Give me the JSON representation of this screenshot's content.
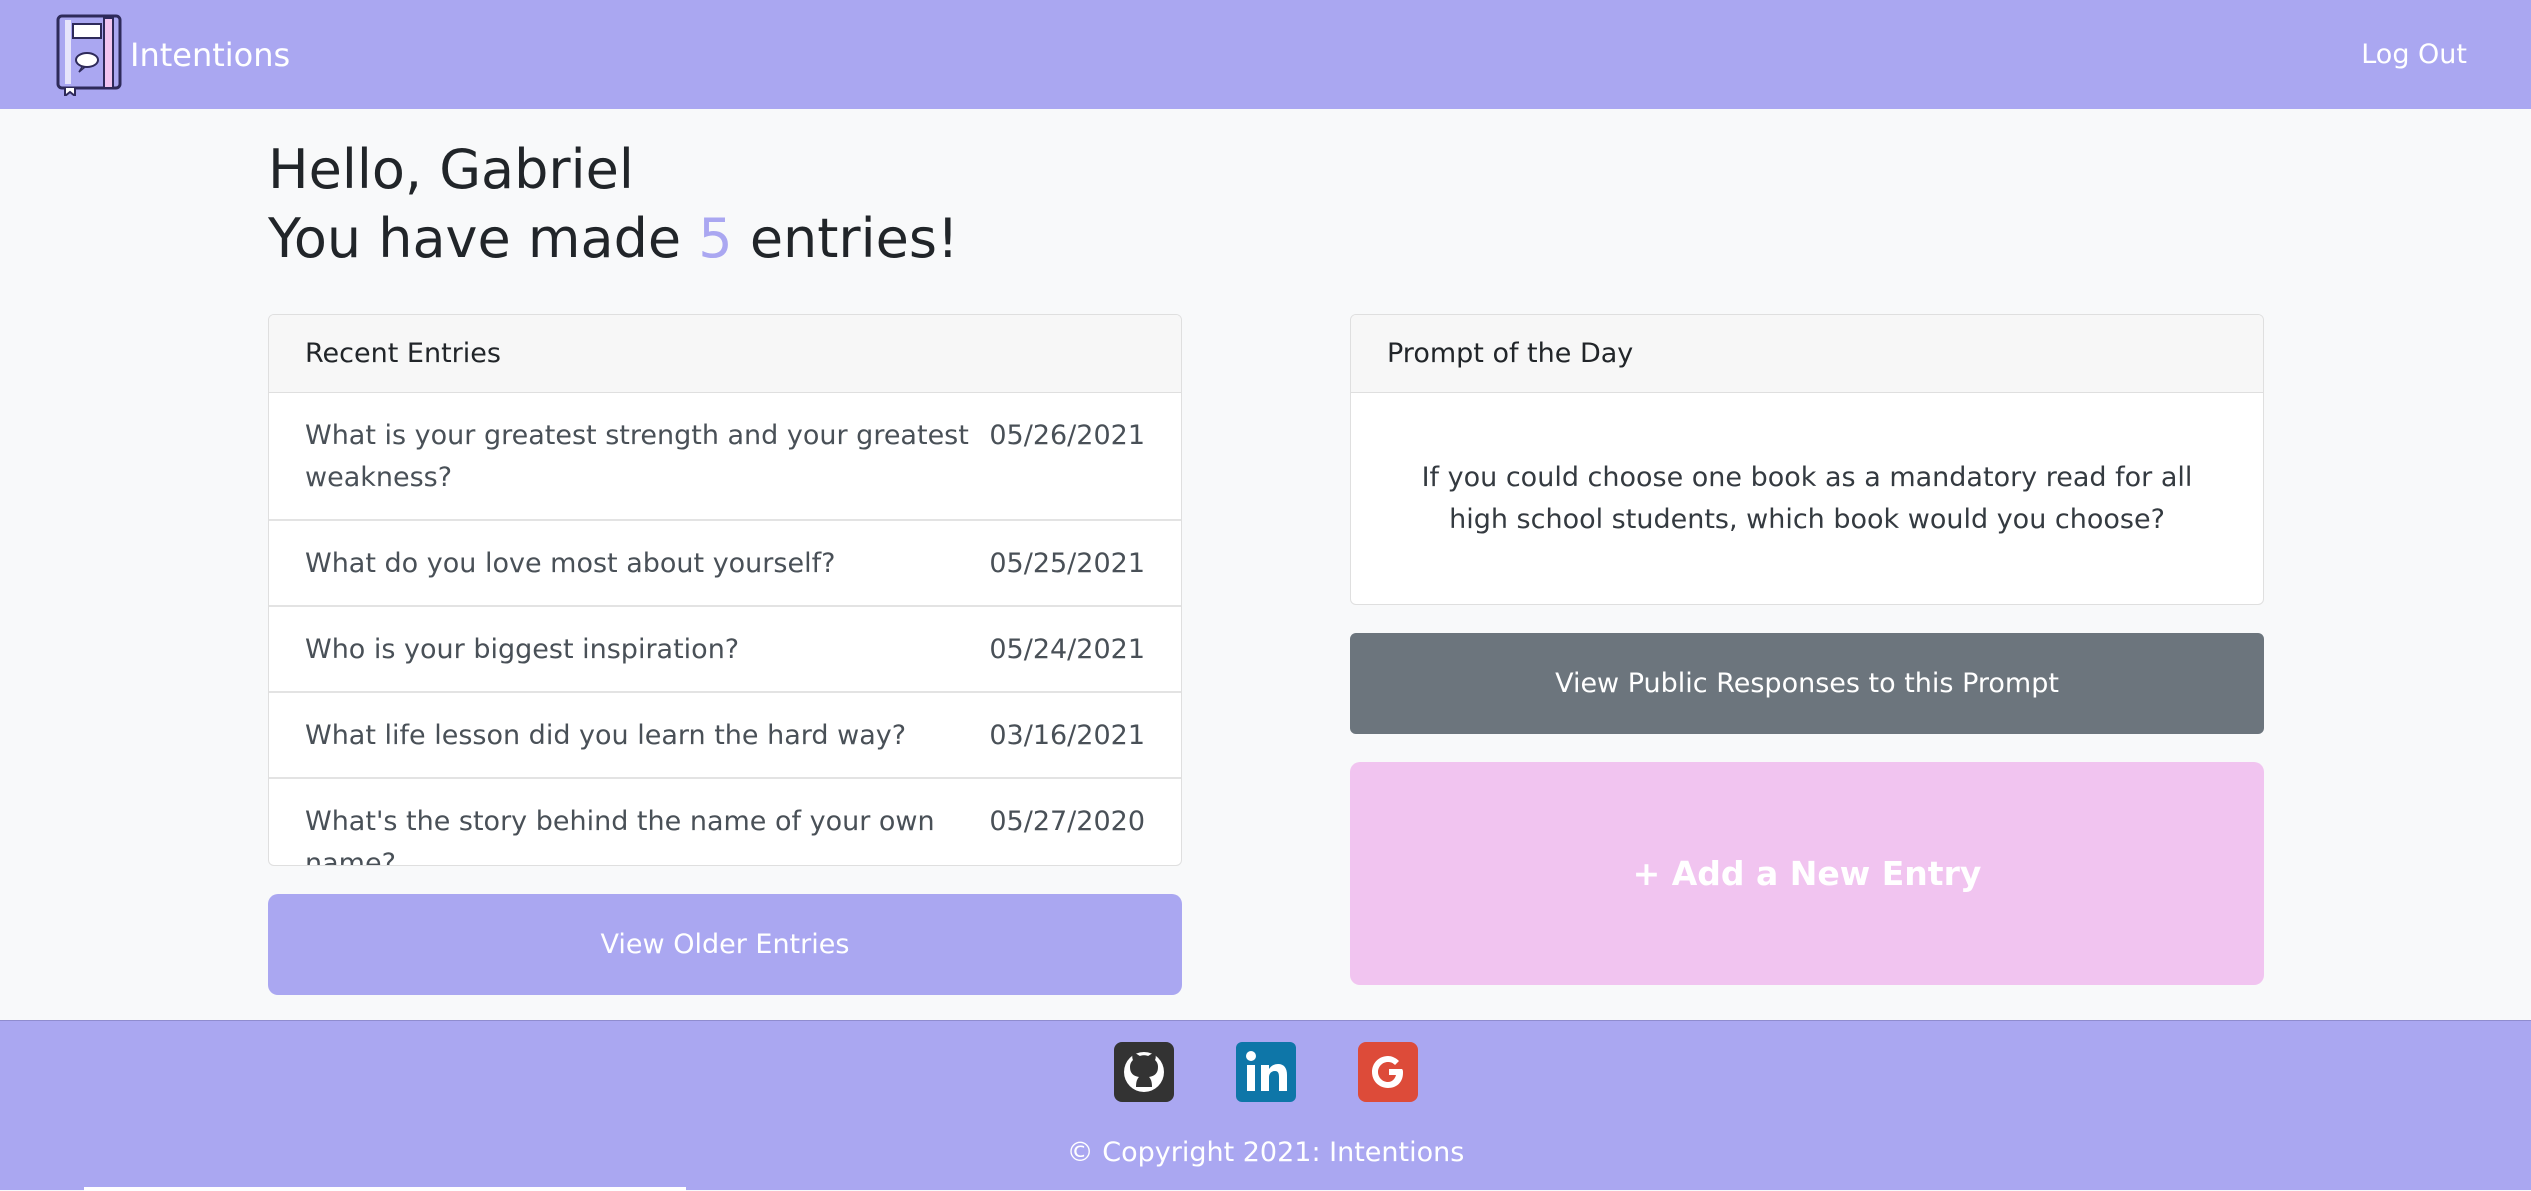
{
  "app": {
    "brand": "Intentions",
    "logout_label": "Log Out"
  },
  "greeting": {
    "hello": "Hello, Gabriel",
    "prefix": "You have made",
    "count": "5",
    "suffix": "entries!"
  },
  "recent": {
    "header": "Recent Entries",
    "entries": [
      {
        "question": "What is your greatest strength and your greatest weakness?",
        "date": "05/26/2021"
      },
      {
        "question": "What do you love most about yourself?",
        "date": "05/25/2021"
      },
      {
        "question": "Who is your biggest inspiration?",
        "date": "05/24/2021"
      },
      {
        "question": "What life lesson did you learn the hard way?",
        "date": "03/16/2021"
      },
      {
        "question": "What's the story behind the name of your own name?",
        "date": "05/27/2020"
      }
    ],
    "older_button": "View Older Entries"
  },
  "prompt": {
    "header": "Prompt of the Day",
    "text": "If you could choose one book as a mandatory read for all high school students, which book would you choose?",
    "public_button": "View Public Responses to this Prompt",
    "add_button": "+ Add a New Entry"
  },
  "footer": {
    "icons": [
      "github-icon",
      "linkedin-icon",
      "google-icon"
    ],
    "copyright": "© Copyright 2021: Intentions"
  },
  "colors": {
    "brand": "#aaa7f1",
    "add_button": "#f1c4f0",
    "secondary_button": "#6c757d",
    "github": "#333333",
    "linkedin": "#0e76a8",
    "google": "#dd4b39"
  }
}
